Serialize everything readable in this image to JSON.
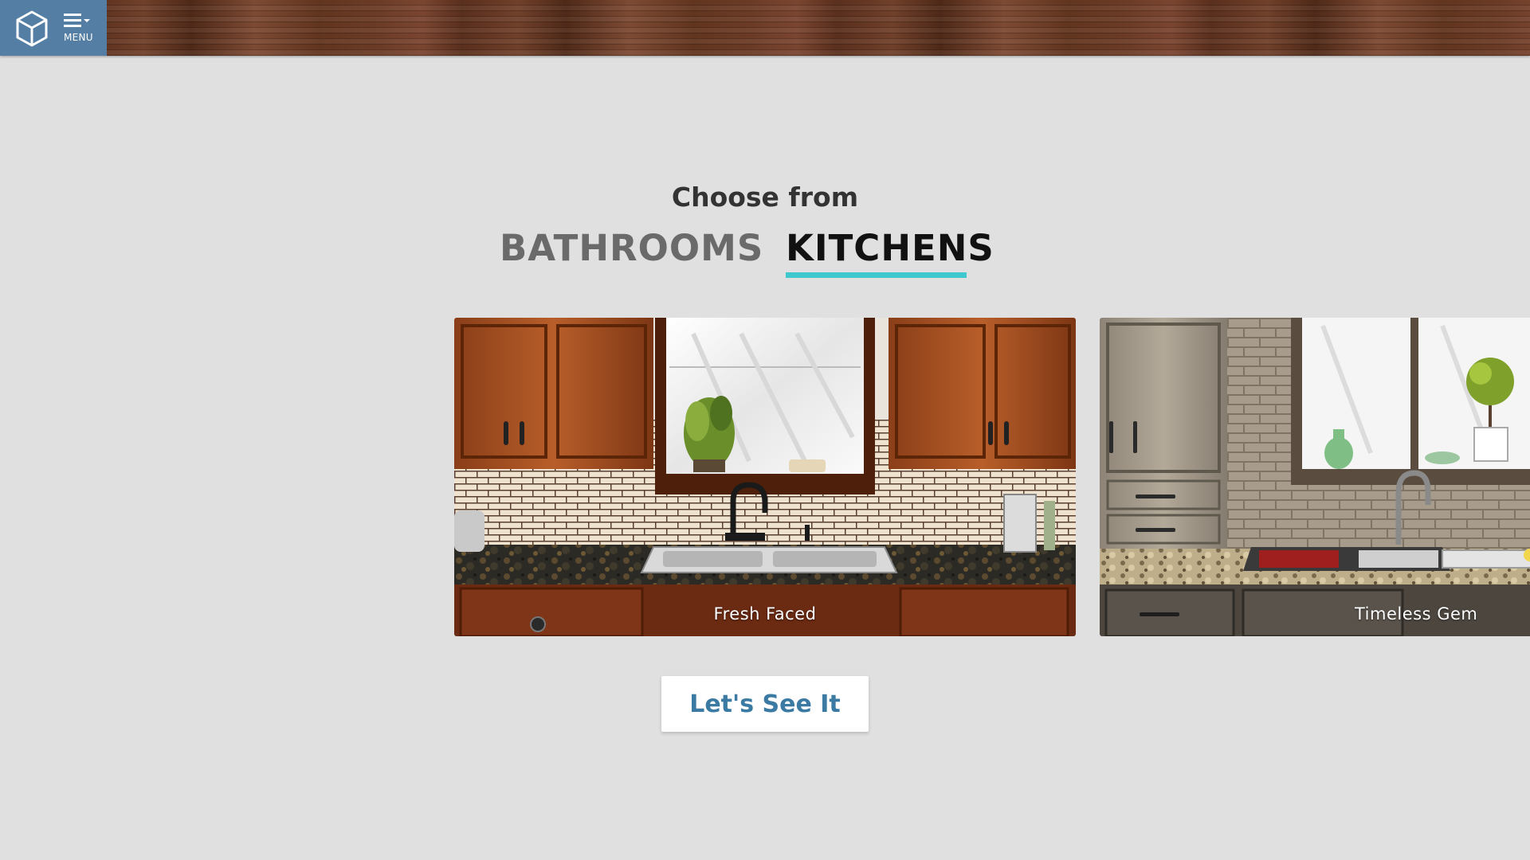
{
  "header": {
    "logo_icon": "cube-logo-icon",
    "menu_icon": "hamburger-dropdown-icon",
    "menu_label": "MENU",
    "brand_color": "#547ea3"
  },
  "main": {
    "heading": "Choose from",
    "tabs": [
      {
        "label": "BATHROOMS",
        "active": false
      },
      {
        "label": "KITCHENS",
        "active": true
      }
    ],
    "active_tab_color": "#3fc9cf",
    "cards": [
      {
        "caption": "Fresh Faced"
      },
      {
        "caption": "Timeless Gem"
      }
    ],
    "cta_label": "Let's See It",
    "cta_color": "#3a7aa3"
  }
}
